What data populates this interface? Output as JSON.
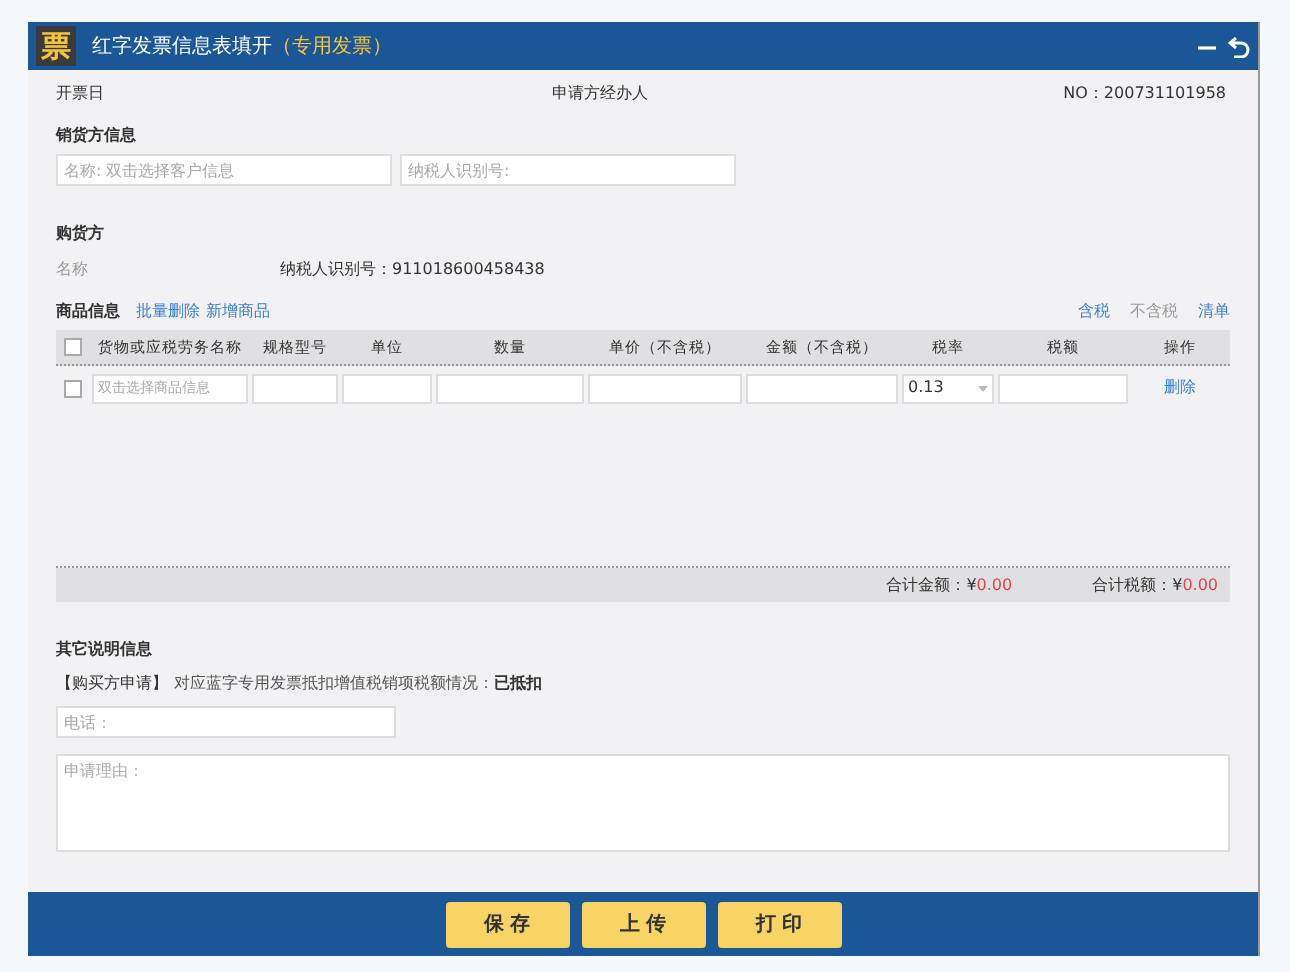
{
  "window": {
    "icon_char": "票",
    "title": "红字发票信息表填开",
    "subtitle": "（专用发票）",
    "controls": [
      {
        "kind": "minimize"
      },
      {
        "kind": "back"
      }
    ]
  },
  "header": {
    "date_label": "开票日",
    "agent_label": "申请方经办人",
    "number": "NO：200731101958"
  },
  "seller": {
    "heading": "销货方信息",
    "fields": [
      {
        "placeholder": "名称: 双击选择客户信息"
      },
      {
        "placeholder": "纳税人识别号:"
      }
    ]
  },
  "buyer": {
    "heading": "购货方",
    "name_label": "名称",
    "tax_id": "纳税人识别号：911018600458438"
  },
  "goods": {
    "heading": "商品信息",
    "actions": [
      "批量删除",
      "新增商品"
    ],
    "modes": [
      {
        "label": "含税",
        "disabled": false
      },
      {
        "label": "不含税",
        "disabled": true
      },
      {
        "label": "清单",
        "disabled": false
      }
    ],
    "columns": [
      {
        "label": "货物或应税劳务名称",
        "checked": false
      },
      {
        "label": "规格型号"
      },
      {
        "label": "单位"
      },
      {
        "label": "数量"
      },
      {
        "label": "单价（不含税）"
      },
      {
        "label": "金额（不含税）"
      },
      {
        "label": "税率"
      },
      {
        "label": "税额"
      },
      {
        "label": "操作"
      }
    ],
    "rows": [
      {
        "checked": false,
        "name_placeholder": "双击选择商品信息",
        "rate": "0.13",
        "action": "删除"
      }
    ],
    "totals": [
      {
        "label": "合计金额：",
        "currency": "¥",
        "value": "0.00"
      },
      {
        "label": "合计税额：",
        "currency": "¥",
        "value": "0.00"
      }
    ]
  },
  "notes": {
    "heading": "其它说明信息",
    "applicant": "【购买方申请】",
    "question": "对应蓝字专用发票抵扣增值税销项税额情况：",
    "answer": "已抵扣",
    "phone_placeholder": "电话：",
    "reason_placeholder": "申请理由："
  },
  "buttons": [
    "保 存",
    "上 传",
    "打 印"
  ]
}
